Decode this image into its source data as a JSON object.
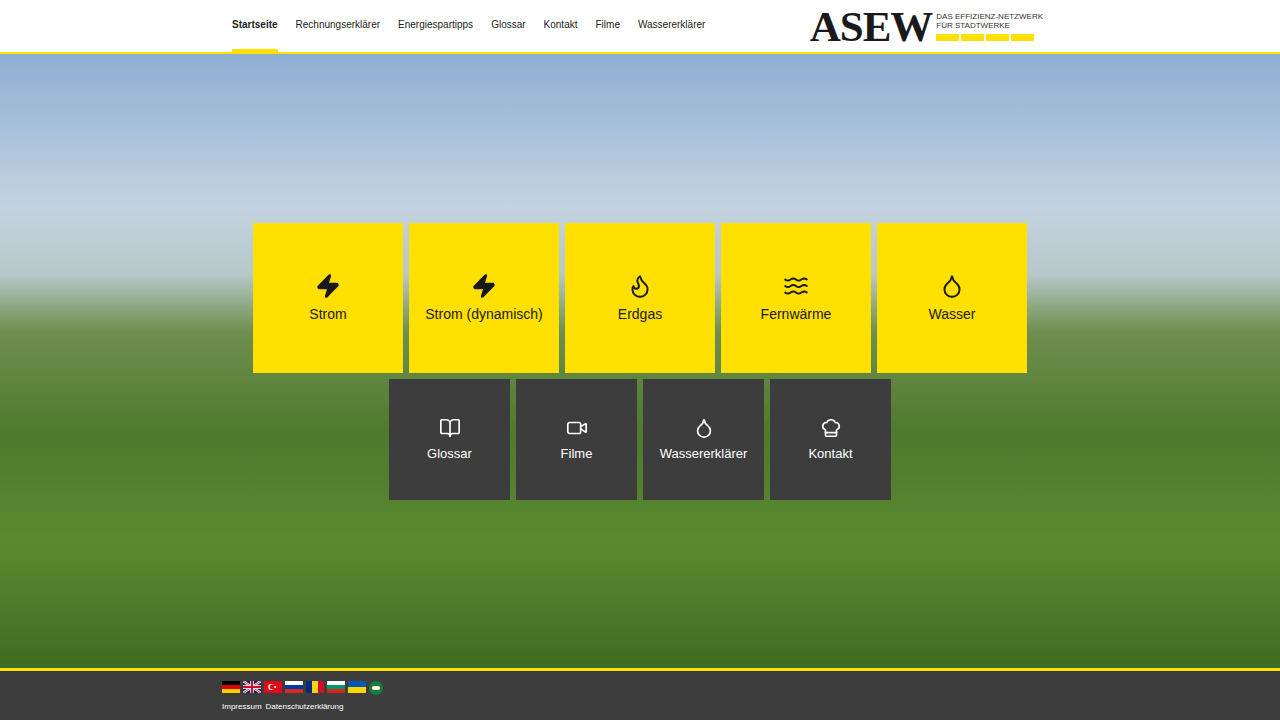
{
  "header": {
    "nav": [
      {
        "label": "Startseite",
        "selected": true
      },
      {
        "label": "Rechnungserklärer",
        "selected": false
      },
      {
        "label": "Energiespartipps",
        "selected": false
      },
      {
        "label": "Glossar",
        "selected": false
      },
      {
        "label": "Kontakt",
        "selected": false
      },
      {
        "label": "Filme",
        "selected": false
      },
      {
        "label": "Wassererklärer",
        "selected": false
      }
    ],
    "logo": {
      "wordmark": "ASEW",
      "tagline_1": "DAS EFFIZIENZ-NETZWERK",
      "tagline_2": "FÜR STADTWERKE"
    }
  },
  "energy_tiles": [
    {
      "label": "Strom",
      "kind": "bolt"
    },
    {
      "label": "Strom (dynamisch)",
      "kind": "bolt"
    },
    {
      "label": "Erdgas",
      "kind": "flame"
    },
    {
      "label": "Fernwärme",
      "kind": "heat"
    },
    {
      "label": "Wasser",
      "kind": "drop"
    }
  ],
  "info_tiles": [
    {
      "label": "Glossar",
      "kind": "book"
    },
    {
      "label": "Filme",
      "kind": "video"
    },
    {
      "label": "Wassererklärer",
      "kind": "drop"
    },
    {
      "label": "Kontakt",
      "kind": "contact"
    }
  ],
  "footer": {
    "links": [
      "Impressum",
      "Datenschutzerklärung"
    ]
  }
}
